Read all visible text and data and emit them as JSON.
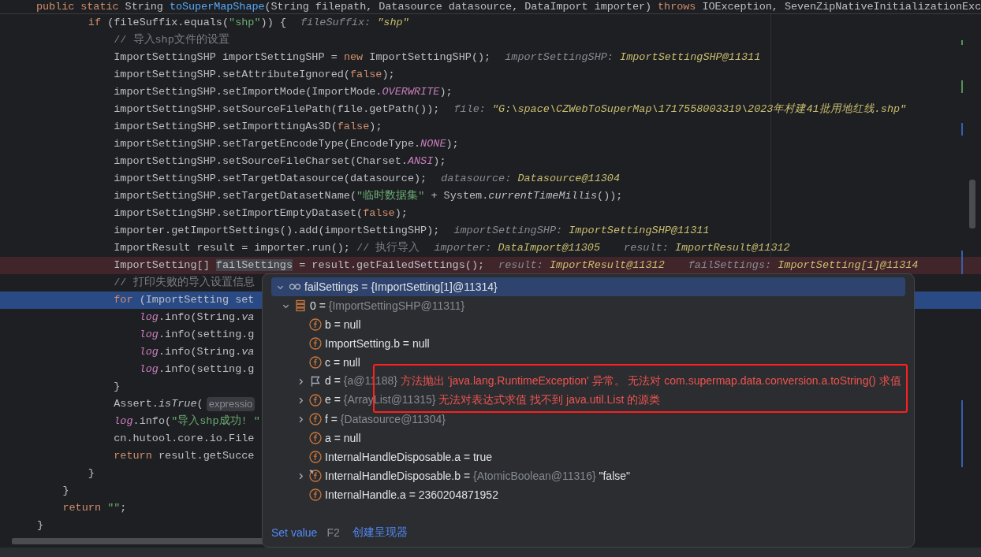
{
  "editor": {
    "sticky_line": {
      "tokens": [
        {
          "text": "public static ",
          "kind": "keyword"
        },
        {
          "text": "String ",
          "kind": "plain"
        },
        {
          "text": "toSuperMapShape",
          "kind": "method"
        },
        {
          "text": "(String filepath, Datasource datasource, DataImport importer) ",
          "kind": "plain"
        },
        {
          "text": "throws ",
          "kind": "keyword"
        },
        {
          "text": "IOException, SevenZipNativeInitializationExc",
          "kind": "plain"
        }
      ]
    },
    "lines": [
      {
        "breakpoint": false,
        "current": false,
        "tokens": [
          {
            "text": "        if ",
            "kind": "keyword"
          },
          {
            "text": "(fileSuffix.equals(",
            "kind": "plain"
          },
          {
            "text": "\"shp\"",
            "kind": "string"
          },
          {
            "text": ")) {",
            "kind": "plain"
          }
        ],
        "hints": [
          {
            "kind": "value",
            "name": "fileSuffix:",
            "value": "\"shp\""
          }
        ]
      },
      {
        "breakpoint": false,
        "current": false,
        "tokens": [
          {
            "text": "            // 导入shp文件的设置",
            "kind": "comment"
          }
        ]
      },
      {
        "breakpoint": false,
        "current": false,
        "tokens": [
          {
            "text": "            ImportSettingSHP importSettingSHP = ",
            "kind": "plain"
          },
          {
            "text": "new ",
            "kind": "keyword"
          },
          {
            "text": "ImportSettingSHP();",
            "kind": "plain"
          }
        ],
        "hints": [
          {
            "kind": "value",
            "name": "importSettingSHP:",
            "value": "ImportSettingSHP@11311"
          }
        ]
      },
      {
        "breakpoint": false,
        "current": false,
        "tokens": [
          {
            "text": "            importSettingSHP.setAttributeIgnored(",
            "kind": "plain"
          },
          {
            "text": "false",
            "kind": "keyword"
          },
          {
            "text": ");",
            "kind": "plain"
          }
        ]
      },
      {
        "breakpoint": false,
        "current": false,
        "tokens": [
          {
            "text": "            importSettingSHP.setImportMode(ImportMode.",
            "kind": "plain"
          },
          {
            "text": "OVERWRITE",
            "kind": "constant"
          },
          {
            "text": ");",
            "kind": "plain"
          }
        ]
      },
      {
        "breakpoint": false,
        "current": false,
        "tokens": [
          {
            "text": "            importSettingSHP.setSourceFilePath(file.getPath());",
            "kind": "plain"
          }
        ],
        "hints": [
          {
            "kind": "value",
            "name": "file:",
            "value": "\"G:\\space\\CZWebToSuperMap\\1717558003319\\2023年村建41批用地红线.shp\""
          }
        ]
      },
      {
        "breakpoint": false,
        "current": false,
        "tokens": [
          {
            "text": "            importSettingSHP.setImporttingAs3D(",
            "kind": "plain"
          },
          {
            "text": "false",
            "kind": "keyword"
          },
          {
            "text": ");",
            "kind": "plain"
          }
        ]
      },
      {
        "breakpoint": false,
        "current": false,
        "tokens": [
          {
            "text": "            importSettingSHP.setTargetEncodeType(EncodeType.",
            "kind": "plain"
          },
          {
            "text": "NONE",
            "kind": "constant"
          },
          {
            "text": ");",
            "kind": "plain"
          }
        ]
      },
      {
        "breakpoint": false,
        "current": false,
        "tokens": [
          {
            "text": "            importSettingSHP.setSourceFileCharset(Charset.",
            "kind": "plain"
          },
          {
            "text": "ANSI",
            "kind": "constant"
          },
          {
            "text": ");",
            "kind": "plain"
          }
        ]
      },
      {
        "breakpoint": false,
        "current": false,
        "tokens": [
          {
            "text": "            importSettingSHP.setTargetDatasource(datasource);",
            "kind": "plain"
          }
        ],
        "hints": [
          {
            "kind": "value",
            "name": "datasource:",
            "value": "Datasource@11304"
          }
        ]
      },
      {
        "breakpoint": false,
        "current": false,
        "tokens": [
          {
            "text": "            importSettingSHP.setTargetDatasetName(",
            "kind": "plain"
          },
          {
            "text": "\"临时数据集\"",
            "kind": "string"
          },
          {
            "text": " + System.",
            "kind": "plain"
          },
          {
            "text": "currentTimeMillis",
            "kind": "static"
          },
          {
            "text": "());",
            "kind": "plain"
          }
        ]
      },
      {
        "breakpoint": false,
        "current": false,
        "tokens": [
          {
            "text": "            importSettingSHP.setImportEmptyDataset(",
            "kind": "plain"
          },
          {
            "text": "false",
            "kind": "keyword"
          },
          {
            "text": ");",
            "kind": "plain"
          }
        ]
      },
      {
        "breakpoint": false,
        "current": false,
        "tokens": [
          {
            "text": "            importer.getImportSettings().add(importSettingSHP);",
            "kind": "plain"
          }
        ],
        "hints": [
          {
            "kind": "value",
            "name": "importSettingSHP:",
            "value": "ImportSettingSHP@11311"
          }
        ]
      },
      {
        "breakpoint": false,
        "current": false,
        "tokens": [
          {
            "text": "            ImportResult result = importer.run(); ",
            "kind": "plain"
          },
          {
            "text": "// 执行导入",
            "kind": "comment"
          }
        ],
        "hints": [
          {
            "kind": "value",
            "name": "importer:",
            "value": "DataImport@11305"
          },
          {
            "kind": "value",
            "name": "result:",
            "value": "ImportResult@11312"
          }
        ]
      },
      {
        "breakpoint": true,
        "current": false,
        "tokens": [
          {
            "text": "            ImportSetting[] ",
            "kind": "plain"
          },
          {
            "text": "failSettings",
            "kind": "selected"
          },
          {
            "text": " = result.getFailedSettings();",
            "kind": "plain"
          }
        ],
        "hints": [
          {
            "kind": "value",
            "name": "result:",
            "value": "ImportResult@11312"
          },
          {
            "kind": "value",
            "name": "failSettings:",
            "value": "ImportSetting[1]@11314"
          }
        ]
      },
      {
        "breakpoint": false,
        "current": false,
        "tokens": [
          {
            "text": "            // 打印失败的导入设置信息",
            "kind": "comment"
          }
        ]
      },
      {
        "breakpoint": false,
        "current": true,
        "tokens": [
          {
            "text": "            for ",
            "kind": "keyword"
          },
          {
            "text": "(ImportSetting set",
            "kind": "plain"
          }
        ]
      },
      {
        "breakpoint": false,
        "current": false,
        "tokens": [
          {
            "text": "                log",
            "kind": "field"
          },
          {
            "text": ".info(String.",
            "kind": "plain"
          },
          {
            "text": "va",
            "kind": "static"
          }
        ]
      },
      {
        "breakpoint": false,
        "current": false,
        "tokens": [
          {
            "text": "                log",
            "kind": "field"
          },
          {
            "text": ".info(setting.g",
            "kind": "plain"
          }
        ]
      },
      {
        "breakpoint": false,
        "current": false,
        "tokens": [
          {
            "text": "                log",
            "kind": "field"
          },
          {
            "text": ".info(String.",
            "kind": "plain"
          },
          {
            "text": "va",
            "kind": "static"
          }
        ]
      },
      {
        "breakpoint": false,
        "current": false,
        "tokens": [
          {
            "text": "                log",
            "kind": "field"
          },
          {
            "text": ".info(setting.g",
            "kind": "plain"
          }
        ]
      },
      {
        "breakpoint": false,
        "current": false,
        "tokens": [
          {
            "text": "            }",
            "kind": "plain"
          }
        ]
      },
      {
        "breakpoint": false,
        "current": false,
        "tokens": [
          {
            "text": "            Assert.",
            "kind": "plain"
          },
          {
            "text": "isTrue",
            "kind": "static"
          },
          {
            "text": "(",
            "kind": "plain"
          }
        ],
        "hints": [
          {
            "kind": "param",
            "name": "expressio"
          }
        ]
      },
      {
        "breakpoint": false,
        "current": false,
        "tokens": [
          {
            "text": "            log",
            "kind": "field"
          },
          {
            "text": ".info(",
            "kind": "plain"
          },
          {
            "text": "\"导入shp成功! \"",
            "kind": "string"
          }
        ]
      },
      {
        "breakpoint": false,
        "current": false,
        "tokens": [
          {
            "text": "            cn.hutool.core.io.File",
            "kind": "plain"
          }
        ]
      },
      {
        "breakpoint": false,
        "current": false,
        "tokens": [
          {
            "text": "            return ",
            "kind": "keyword"
          },
          {
            "text": "result.getSucce",
            "kind": "plain"
          }
        ]
      },
      {
        "breakpoint": false,
        "current": false,
        "tokens": [
          {
            "text": "        }",
            "kind": "plain"
          }
        ]
      },
      {
        "breakpoint": false,
        "current": false,
        "tokens": [
          {
            "text": "    }",
            "kind": "plain"
          }
        ]
      },
      {
        "breakpoint": false,
        "current": false,
        "tokens": [
          {
            "text": "    return ",
            "kind": "keyword"
          },
          {
            "text": "\"\"",
            "kind": "string"
          },
          {
            "text": ";",
            "kind": "plain"
          }
        ]
      },
      {
        "breakpoint": false,
        "current": false,
        "tokens": [
          {
            "text": "}",
            "kind": "plain"
          }
        ]
      }
    ]
  },
  "debug_popup": {
    "tree": {
      "kind": "watch",
      "selected": true,
      "expanded": true,
      "parts": [
        {
          "text": "failSettings = ",
          "kind": "plain"
        },
        {
          "text": "{ImportSetting[1]@11314}",
          "kind": "plain"
        }
      ],
      "children": [
        {
          "kind": "array",
          "selected": false,
          "expanded": true,
          "parts": [
            {
              "text": "0 = ",
              "kind": "plain"
            },
            {
              "text": "{ImportSettingSHP@11311}",
              "kind": "ref"
            }
          ],
          "children": [
            {
              "kind": "field",
              "selected": false,
              "parts": [
                {
                  "text": "b = null",
                  "kind": "plain"
                }
              ]
            },
            {
              "kind": "field",
              "selected": false,
              "parts": [
                {
                  "text": "ImportSetting.b = null",
                  "kind": "plain"
                }
              ]
            },
            {
              "kind": "field",
              "selected": false,
              "parts": [
                {
                  "text": "c = null",
                  "kind": "plain"
                }
              ]
            },
            {
              "kind": "flag",
              "selected": false,
              "expanded": false,
              "parts": [
                {
                  "text": "d = ",
                  "kind": "plain"
                },
                {
                  "text": "{a@11188} ",
                  "kind": "ref"
                },
                {
                  "text": "方法抛出 'java.lang.RuntimeException' 异常。 无法对 com.supermap.data.conversion.a.toString() 求值",
                  "kind": "error"
                }
              ]
            },
            {
              "kind": "field",
              "selected": false,
              "expanded": false,
              "parts": [
                {
                  "text": "e = ",
                  "kind": "plain"
                },
                {
                  "text": "{ArrayList@11315} ",
                  "kind": "ref"
                },
                {
                  "text": "无法对表达式求值 找不到 java.util.List 的源类",
                  "kind": "error"
                }
              ]
            },
            {
              "kind": "field",
              "selected": false,
              "expanded": false,
              "parts": [
                {
                  "text": "f = ",
                  "kind": "plain"
                },
                {
                  "text": "{Datasource@11304}",
                  "kind": "ref"
                }
              ]
            },
            {
              "kind": "field",
              "selected": false,
              "parts": [
                {
                  "text": "a = null",
                  "kind": "plain"
                }
              ]
            },
            {
              "kind": "field",
              "selected": false,
              "parts": [
                {
                  "text": "InternalHandleDisposable.a = true",
                  "kind": "plain"
                }
              ]
            },
            {
              "kind": "linked-field",
              "selected": false,
              "expanded": false,
              "parts": [
                {
                  "text": "InternalHandleDisposable.b = ",
                  "kind": "plain"
                },
                {
                  "text": "{AtomicBoolean@11316} ",
                  "kind": "ref"
                },
                {
                  "text": "\"false\"",
                  "kind": "plain"
                }
              ]
            },
            {
              "kind": "field",
              "selected": false,
              "parts": [
                {
                  "text": "InternalHandle.a = 2360204871952",
                  "kind": "plain"
                }
              ]
            }
          ]
        }
      ]
    },
    "footer": [
      {
        "kind": "link",
        "text": "Set value"
      },
      {
        "kind": "shortcut",
        "text": "F2"
      },
      {
        "kind": "link",
        "text": "创建呈现器"
      }
    ]
  }
}
